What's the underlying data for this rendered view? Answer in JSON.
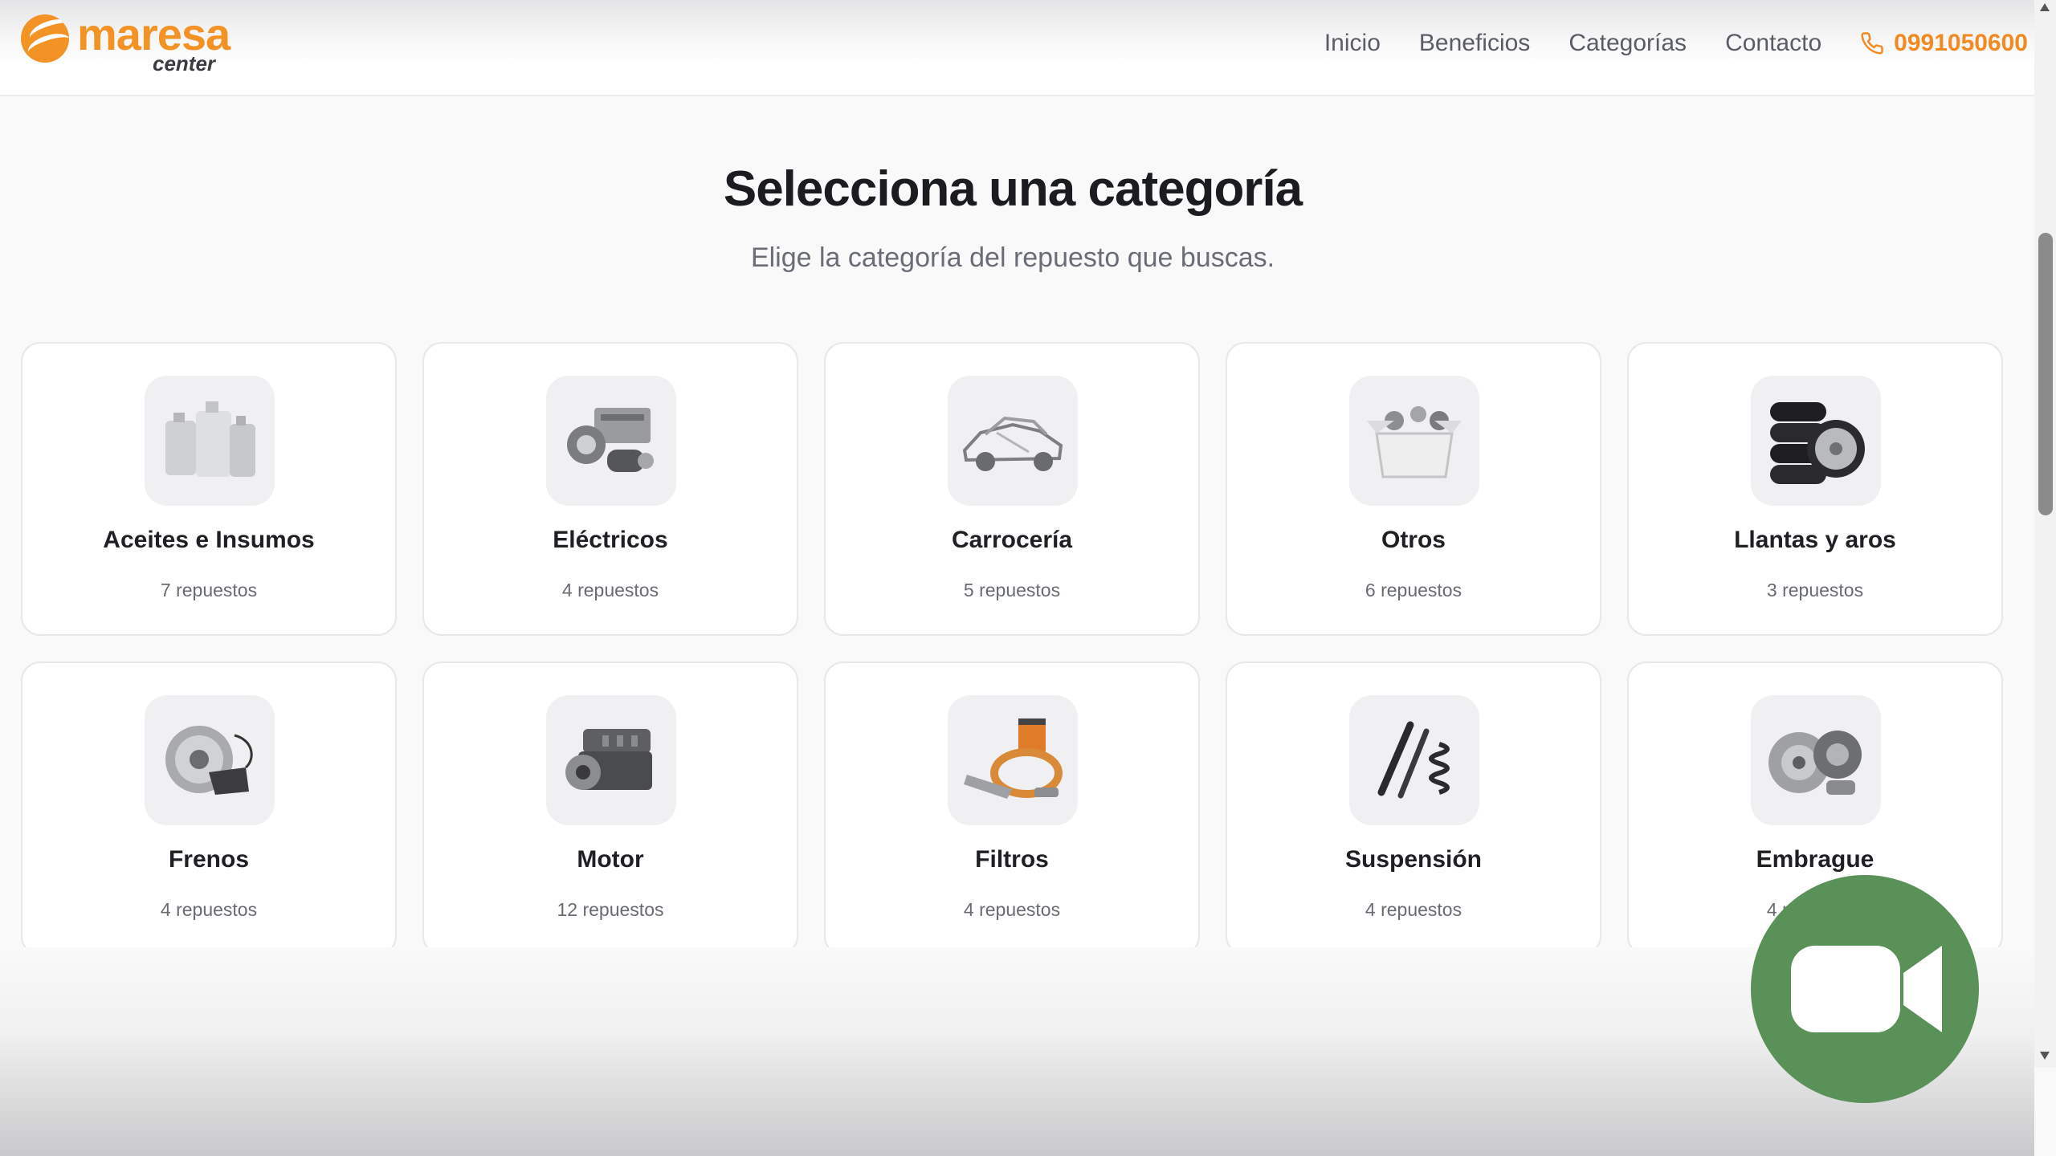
{
  "header": {
    "logo_text": "maresa",
    "logo_sub": "center",
    "nav": [
      "Inicio",
      "Beneficios",
      "Categorías",
      "Contacto"
    ],
    "phone": "0991050600",
    "colors": {
      "brand": "#f39325",
      "phone": "#f28a23"
    }
  },
  "hero": {
    "title": "Selecciona una categoría",
    "subtitle": "Elige la categoría del repuesto que buscas."
  },
  "categories": [
    {
      "name": "Aceites e Insumos",
      "count": "7 repuestos",
      "icon": "oil-bottles-icon"
    },
    {
      "name": "Eléctricos",
      "count": "4 repuestos",
      "icon": "electrical-parts-icon"
    },
    {
      "name": "Carrocería",
      "count": "5 repuestos",
      "icon": "car-body-icon"
    },
    {
      "name": "Otros",
      "count": "6 repuestos",
      "icon": "parts-box-icon"
    },
    {
      "name": "Llantas y aros",
      "count": "3 repuestos",
      "icon": "tires-rims-icon"
    },
    {
      "name": "Frenos",
      "count": "4 repuestos",
      "icon": "brake-disc-icon"
    },
    {
      "name": "Motor",
      "count": "12 repuestos",
      "icon": "engine-icon"
    },
    {
      "name": "Filtros",
      "count": "4 repuestos",
      "icon": "filters-icon"
    },
    {
      "name": "Suspensión",
      "count": "4 repuestos",
      "icon": "shock-absorber-icon"
    },
    {
      "name": "Embrague",
      "count": "4 repuestos",
      "icon": "clutch-kit-icon"
    }
  ],
  "video_button": {
    "icon": "video-camera-icon",
    "color": "#5a9159"
  }
}
